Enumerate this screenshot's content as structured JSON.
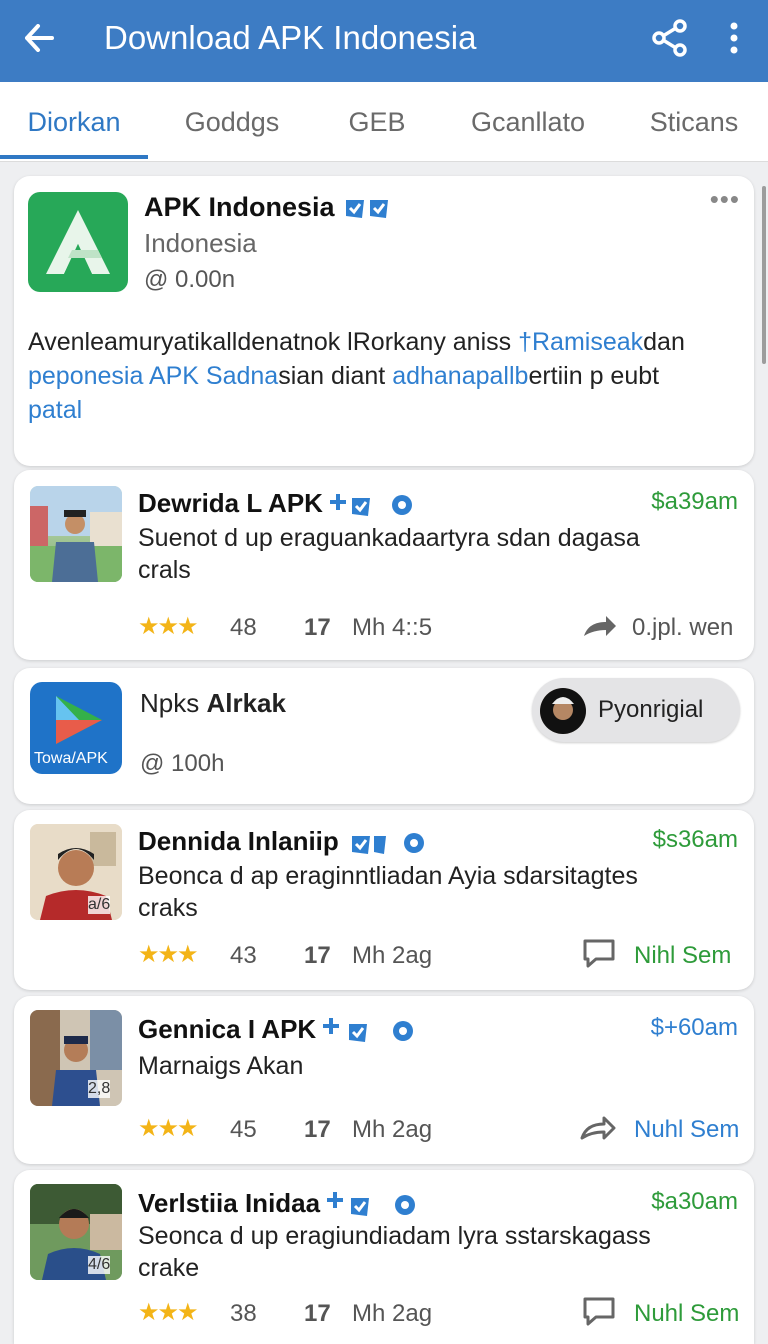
{
  "appbar": {
    "title": "Download APK Indonesia",
    "back_icon": "back-arrow-icon",
    "share_icon": "share-icon",
    "more_icon": "more-vert-icon",
    "color": "#3d7cc4"
  },
  "tabs": [
    "Diorkan",
    "Goddgs",
    "GEB",
    "Gcanllato",
    "Sticans"
  ],
  "active_tab": 0,
  "accent": "#2f78c4",
  "header_card": {
    "name": "APK Indonesia",
    "subtitle": "Indonesia",
    "count": "@ 0.00n",
    "desc_line1_a": "Avenleamuryatikalldenatnok lRorkany aniss ",
    "desc_line1_b": "†Ramiseak",
    "desc_line1_c": "dan",
    "desc_line2_a": "peponesia APK Sadna",
    "desc_line2_b": "sian diant ",
    "desc_line2_c": "adhanapallb",
    "desc_line2_d": "ertiin p eubt",
    "desc_line3": "patal"
  },
  "posts": [
    {
      "name": "Dewrida L APK",
      "time": "$a39am",
      "text1": "Suenot  d up eraguankadaartyra sdan dagasa",
      "text2": "crals",
      "rating": "48",
      "count": "17",
      "mh": "Mh 4::5",
      "action": "0.jpl. wen",
      "action_icon": "share-arrow-icon"
    },
    {
      "name": "Dennida Inlaniip",
      "time": "$s36am",
      "text1": "Beonca d ap eraginntliadan Ayia sdarsitagtes",
      "text2": "craks",
      "badge": "a/6",
      "rating": "43",
      "count": "17",
      "mh": "Mh 2ag",
      "action": "Nihl Sem",
      "action_icon": "comment-icon"
    },
    {
      "name": "Gennica I APK",
      "time": "$+60am",
      "text1": "Marnaigs Akan",
      "badge": "2,8",
      "rating": "45",
      "count": "17",
      "mh": "Mh 2ag",
      "action": "Nuhl Sem",
      "action_icon": "share-arrow-icon"
    },
    {
      "name": "Verlstiia Inidaa",
      "time": "$a30am",
      "text1": "Seonca d up eragiundiadam lyra sstarskagass",
      "text2": "crake",
      "badge": "4/6",
      "rating": "38",
      "count": "17",
      "mh": "Mh 2ag",
      "action": "Nuhl Sem",
      "action_icon": "comment-icon"
    }
  ],
  "app_card": {
    "name_a": "Npks ",
    "name_b": "Alrkak",
    "icon_label": "Towa/APK",
    "count": "@ 100h",
    "button": "Pyonrigial"
  }
}
